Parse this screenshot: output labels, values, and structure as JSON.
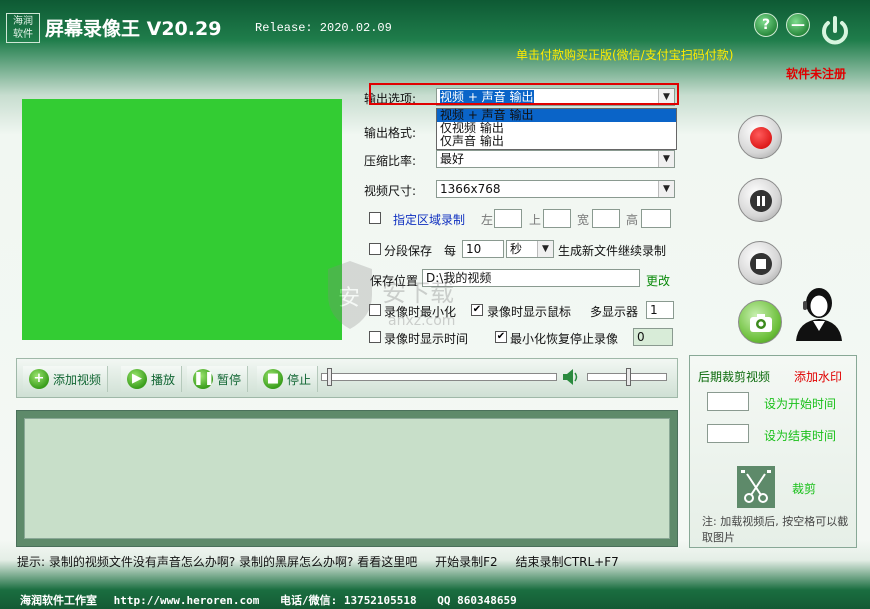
{
  "header": {
    "logo": "海润\n软件",
    "title": "屏幕录像王 V20.29",
    "release": "Release: 2020.02.09",
    "help": "?",
    "minimize": "—",
    "buy": "单击付款购买正版(微信/支付宝扫码付款)",
    "unregistered": "软件未注册"
  },
  "options": {
    "output_option_label": "输出选项:",
    "output_option_value": "视频 + 声音 输出",
    "dropdown_items": [
      "视频 + 声音 输出",
      "仅视频 输出",
      "仅声音 输出"
    ],
    "output_format_label": "输出格式:",
    "compression_label": "压缩比率:",
    "compression_value": "最好",
    "video_size_label": "视频尺寸:",
    "video_size_value": "1366x768",
    "region_label": "指定区域录制",
    "left": "左",
    "top": "上",
    "width": "宽",
    "height": "高",
    "segment_label": "分段保存",
    "every": "每",
    "segment_value": "10",
    "unit": "秒",
    "segment_tail": "生成新文件继续录制",
    "save_label": "保存位置",
    "save_path": "D:\\我的视频",
    "change": "更改",
    "min_on_record": "录像时最小化",
    "show_cursor": "录像时显示鼠标",
    "multi_monitor": "多显示器",
    "monitor_value": "1",
    "show_time": "录像时显示时间",
    "restore_stop": "最小化恢复停止录像",
    "stop_value": "0"
  },
  "player": {
    "add": "添加视频",
    "play": "播放",
    "pause": "暂停",
    "stop": "停止"
  },
  "cut": {
    "title": "后期裁剪视频",
    "watermark": "添加水印",
    "set_start": "设为开始时间",
    "set_end": "设为结束时间",
    "crop": "裁剪",
    "note": "注: 加载视频后, 按空格可以截取图片"
  },
  "tip": {
    "text": "提示: 录制的视频文件没有声音怎么办啊? 录制的黑屏怎么办啊? 看看这里吧",
    "start": "开始录制F2",
    "end": "结束录制CTRL+F7"
  },
  "footer": {
    "studio": "海润软件工作室",
    "url": "http://www.heroren.com",
    "phone": "电话/微信: 13752105518",
    "qq": "QQ 860348659"
  },
  "watermark": {
    "line1": "安下载",
    "line2": "anxz.com"
  },
  "colors": {
    "accent": "#1f7d4b",
    "record": "#e00000",
    "preview": "#33cc33"
  }
}
